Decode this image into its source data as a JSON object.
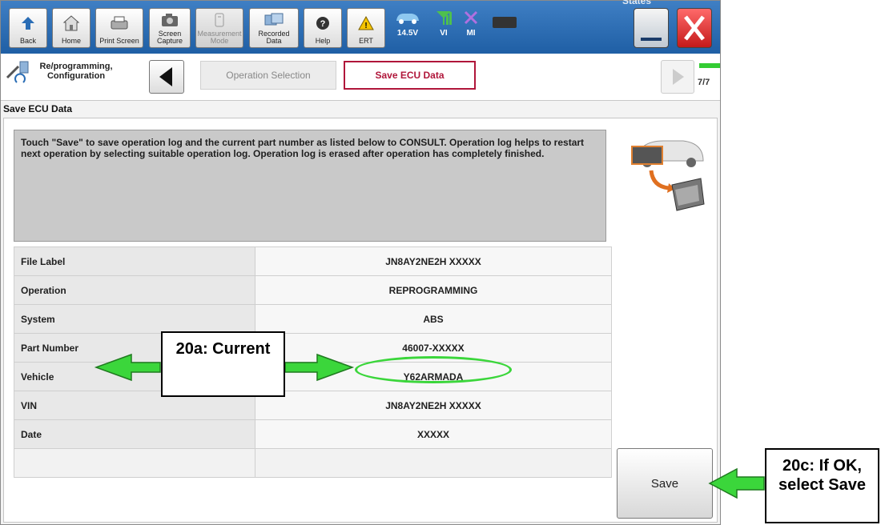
{
  "toolbar": {
    "buttons": [
      {
        "label": "Back",
        "icon": "back-arrow-icon"
      },
      {
        "label": "Home",
        "icon": "home-icon"
      },
      {
        "label": "Print Screen",
        "icon": "printer-icon"
      },
      {
        "label": "Screen Capture",
        "icon": "camera-icon"
      },
      {
        "label": "Measurement Mode",
        "icon": "measurement-icon"
      },
      {
        "label": "Recorded Data",
        "icon": "recorded-data-icon"
      },
      {
        "label": "Help",
        "icon": "help-icon"
      },
      {
        "label": "ERT",
        "icon": "warning-icon"
      }
    ],
    "voltage": "14.5V",
    "vi_label": "VI",
    "mi_label": "MI",
    "states_label": "States"
  },
  "nav": {
    "breadcrumb": "Re/programming, Configuration",
    "tabs": [
      {
        "label": "Operation Selection",
        "active": false
      },
      {
        "label": "Save ECU Data",
        "active": true
      }
    ],
    "step": "7/7"
  },
  "section_title": "Save ECU Data",
  "message": "Touch \"Save\" to save operation log and the current part number as listed below to CONSULT. Operation log helps to restart next operation by selecting suitable operation log. Operation log is erased after operation has completely finished.",
  "rows": [
    {
      "key": "File Label",
      "value": "JN8AY2NE2H XXXXX"
    },
    {
      "key": "Operation",
      "value": "REPROGRAMMING"
    },
    {
      "key": "System",
      "value": "ABS"
    },
    {
      "key": "Part Number",
      "value": "46007-XXXXX"
    },
    {
      "key": "Vehicle",
      "value": "Y62ARMADA"
    },
    {
      "key": "VIN",
      "value": "JN8AY2NE2H XXXXX"
    },
    {
      "key": "Date",
      "value": "XXXXX"
    }
  ],
  "save_label": "Save",
  "callouts": {
    "current": "20a: Current",
    "save": "20c: If OK, select Save"
  },
  "colors": {
    "accent_green": "#33cc33",
    "tab_active": "#b0163a",
    "toolbar_blue": "#2a6db5"
  }
}
